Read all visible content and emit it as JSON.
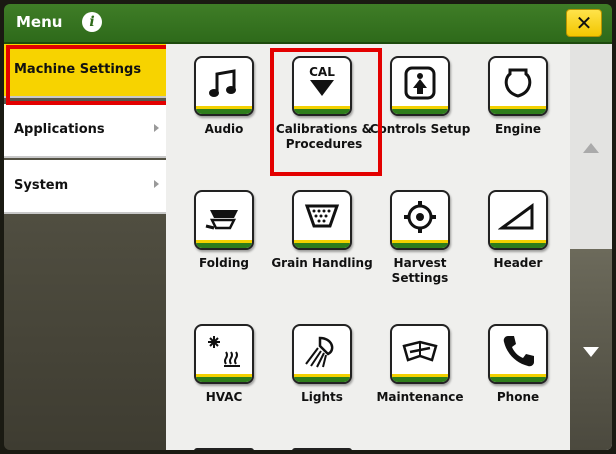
{
  "header": {
    "title": "Menu",
    "info_icon": "info-icon",
    "close_label": "✕"
  },
  "sidebar": {
    "items": [
      {
        "label": "Machine Settings",
        "active": true
      },
      {
        "label": "Applications",
        "active": false
      },
      {
        "label": "System",
        "active": false
      }
    ]
  },
  "tiles": [
    {
      "label": "Audio",
      "icon": "music-note-icon"
    },
    {
      "label": "Calibrations & Procedures",
      "icon": "cal-down-arrow-icon",
      "icon_text": "CAL"
    },
    {
      "label": "Controls Setup",
      "icon": "controls-setup-icon"
    },
    {
      "label": "Engine",
      "icon": "engine-icon"
    },
    {
      "label": "Folding",
      "icon": "folding-icon"
    },
    {
      "label": "Grain Handling",
      "icon": "grain-tank-icon"
    },
    {
      "label": "Harvest Settings",
      "icon": "rotor-gear-icon"
    },
    {
      "label": "Header",
      "icon": "header-icon"
    },
    {
      "label": "HVAC",
      "icon": "hvac-icon"
    },
    {
      "label": "Lights",
      "icon": "lights-icon"
    },
    {
      "label": "Maintenance",
      "icon": "maintenance-book-icon"
    },
    {
      "label": "Phone",
      "icon": "phone-icon"
    }
  ],
  "colors": {
    "header_green": "#2e6a1a",
    "active_yellow": "#f7d300",
    "highlight_red": "#e30000",
    "stripe_green": "#2e7d1b",
    "stripe_yellow": "#f3d100"
  }
}
